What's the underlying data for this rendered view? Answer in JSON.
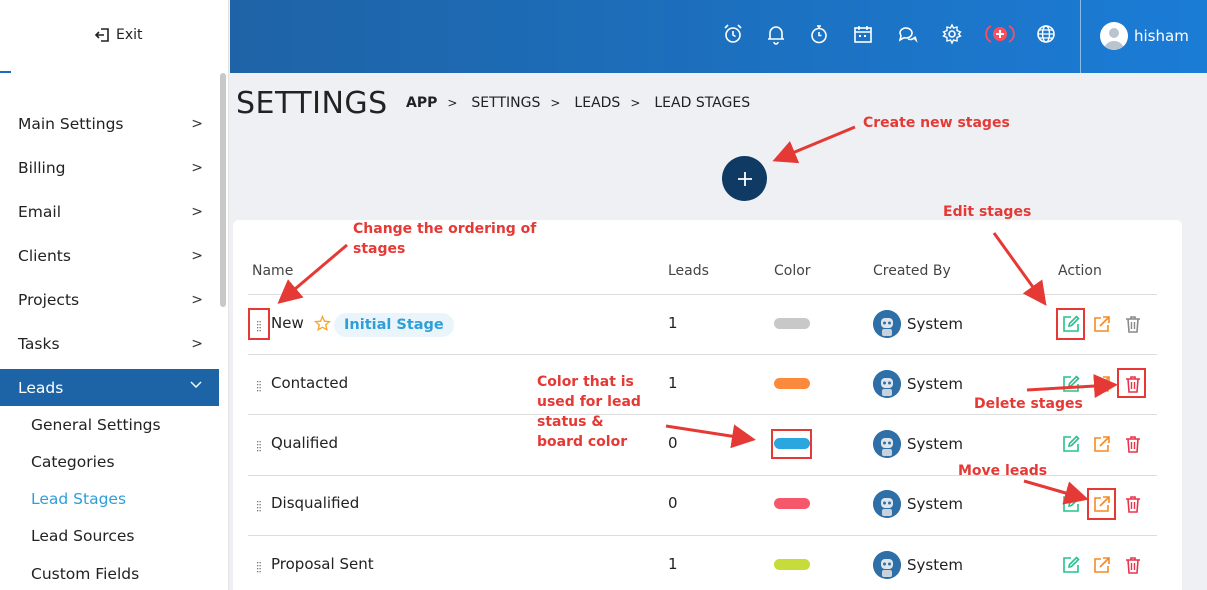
{
  "sidebar": {
    "exit_label": "Exit",
    "items": [
      {
        "label": "Main Settings"
      },
      {
        "label": "Billing"
      },
      {
        "label": "Email"
      },
      {
        "label": "Clients"
      },
      {
        "label": "Projects"
      },
      {
        "label": "Tasks"
      },
      {
        "label": "Leads"
      }
    ],
    "sub_items": [
      {
        "label": "General Settings"
      },
      {
        "label": "Categories"
      },
      {
        "label": "Lead Stages"
      },
      {
        "label": "Lead Sources"
      },
      {
        "label": "Custom Fields"
      }
    ]
  },
  "header": {
    "icons": [
      "alarm-icon",
      "bell-icon",
      "stopwatch-icon",
      "calendar-icon",
      "chat-icon",
      "gear-icon",
      "add-circle-icon",
      "globe-icon"
    ],
    "user_name": "hisham"
  },
  "page": {
    "title": "SETTINGS",
    "breadcrumb": [
      "APP",
      "SETTINGS",
      "LEADS",
      "LEAD STAGES"
    ]
  },
  "table": {
    "headers": {
      "name": "Name",
      "leads": "Leads",
      "color": "Color",
      "created_by": "Created By",
      "action": "Action"
    },
    "initial_badge": "Initial Stage",
    "rows": [
      {
        "name": "New",
        "leads": "1",
        "color": "#c8c8c8",
        "created_by": "System"
      },
      {
        "name": "Contacted",
        "leads": "1",
        "color": "#fb8a3c",
        "created_by": "System"
      },
      {
        "name": "Qualified",
        "leads": "0",
        "color": "#2ba6de",
        "created_by": "System"
      },
      {
        "name": "Disqualified",
        "leads": "0",
        "color": "#f5586a",
        "created_by": "System"
      },
      {
        "name": "Proposal Sent",
        "leads": "1",
        "color": "#c6dc3a",
        "created_by": "System"
      }
    ]
  },
  "annotations": {
    "create": "Create new stages",
    "ordering_1": "Change the ordering of",
    "ordering_2": "stages",
    "edit": "Edit stages",
    "color_1": "Color that is",
    "color_2": "used for lead",
    "color_3": "status &",
    "color_4": "board color",
    "delete": "Delete stages",
    "move": "Move leads"
  },
  "colors": {
    "header_start": "#1e63a6",
    "header_end": "#1b7cd6",
    "active_nav": "#1d64a6",
    "link_blue": "#2f9fd8",
    "edit_green": "#27c28a",
    "move_orange": "#f58a24",
    "delete_red": "#e8344a",
    "annotation_red": "#e53935"
  }
}
